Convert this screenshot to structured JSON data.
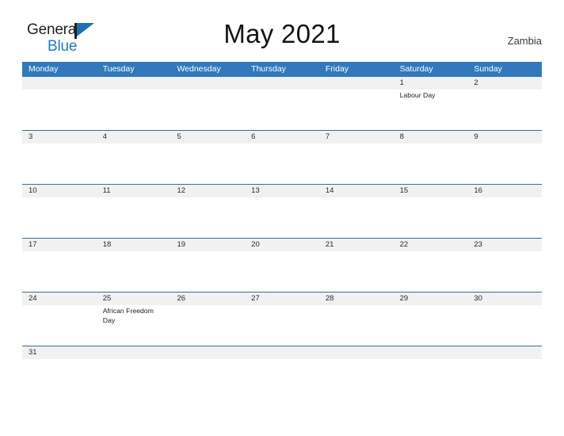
{
  "brand": {
    "name_part1": "General",
    "name_part2": "Blue",
    "mark": "flag-triangle"
  },
  "header": {
    "title": "May 2021",
    "country": "Zambia"
  },
  "calendar": {
    "month": "May",
    "year": "2021",
    "weekdays": [
      "Monday",
      "Tuesday",
      "Wednesday",
      "Thursday",
      "Friday",
      "Saturday",
      "Sunday"
    ],
    "colors": {
      "header_blue": "#3179bc",
      "row_divider_blue": "#2f6fa8",
      "date_band_gray": "#f1f1f1",
      "brand_blue": "#1f7dc4"
    },
    "weeks": [
      {
        "days": [
          {
            "date": "",
            "events": []
          },
          {
            "date": "",
            "events": []
          },
          {
            "date": "",
            "events": []
          },
          {
            "date": "",
            "events": []
          },
          {
            "date": "",
            "events": []
          },
          {
            "date": "1",
            "events": [
              "Labour Day"
            ]
          },
          {
            "date": "2",
            "events": []
          }
        ]
      },
      {
        "days": [
          {
            "date": "3",
            "events": []
          },
          {
            "date": "4",
            "events": []
          },
          {
            "date": "5",
            "events": []
          },
          {
            "date": "6",
            "events": []
          },
          {
            "date": "7",
            "events": []
          },
          {
            "date": "8",
            "events": []
          },
          {
            "date": "9",
            "events": []
          }
        ]
      },
      {
        "days": [
          {
            "date": "10",
            "events": []
          },
          {
            "date": "11",
            "events": []
          },
          {
            "date": "12",
            "events": []
          },
          {
            "date": "13",
            "events": []
          },
          {
            "date": "14",
            "events": []
          },
          {
            "date": "15",
            "events": []
          },
          {
            "date": "16",
            "events": []
          }
        ]
      },
      {
        "days": [
          {
            "date": "17",
            "events": []
          },
          {
            "date": "18",
            "events": []
          },
          {
            "date": "19",
            "events": []
          },
          {
            "date": "20",
            "events": []
          },
          {
            "date": "21",
            "events": []
          },
          {
            "date": "22",
            "events": []
          },
          {
            "date": "23",
            "events": []
          }
        ]
      },
      {
        "days": [
          {
            "date": "24",
            "events": []
          },
          {
            "date": "25",
            "events": [
              "African Freedom Day"
            ]
          },
          {
            "date": "26",
            "events": []
          },
          {
            "date": "27",
            "events": []
          },
          {
            "date": "28",
            "events": []
          },
          {
            "date": "29",
            "events": []
          },
          {
            "date": "30",
            "events": []
          }
        ]
      },
      {
        "short": true,
        "days": [
          {
            "date": "31",
            "events": []
          },
          {
            "date": "",
            "events": []
          },
          {
            "date": "",
            "events": []
          },
          {
            "date": "",
            "events": []
          },
          {
            "date": "",
            "events": []
          },
          {
            "date": "",
            "events": []
          },
          {
            "date": "",
            "events": []
          }
        ]
      }
    ]
  }
}
